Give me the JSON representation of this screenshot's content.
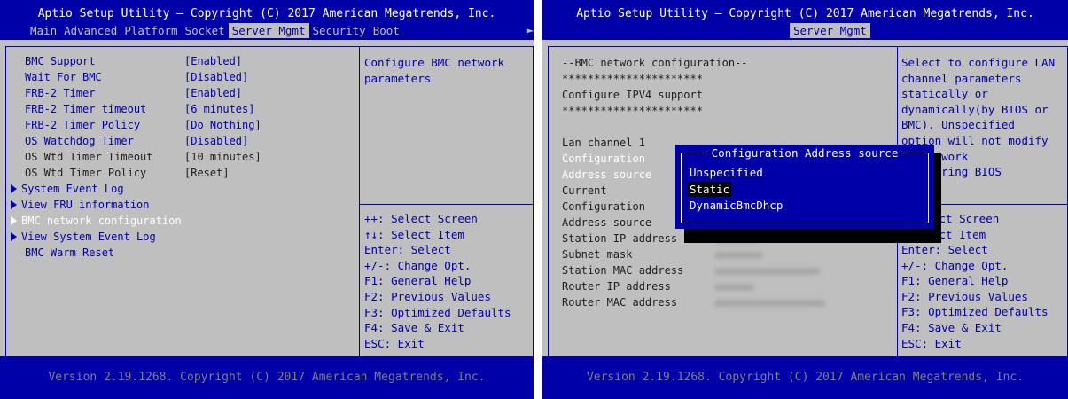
{
  "left": {
    "title": "Aptio Setup Utility – Copyright (C) 2017 American Megatrends, Inc.",
    "tabs": [
      {
        "label": "Main"
      },
      {
        "label": "Advanced"
      },
      {
        "label": "Platform"
      },
      {
        "label": "Socket"
      },
      {
        "label": "Server Mgmt"
      },
      {
        "label": "Security"
      },
      {
        "label": "Boot"
      }
    ],
    "items": [
      {
        "label": "BMC Support",
        "value": "[Enabled]"
      },
      {
        "label": "Wait For BMC",
        "value": "[Disabled]"
      },
      {
        "label": "FRB-2 Timer",
        "value": "[Enabled]"
      },
      {
        "label": "FRB-2 Timer timeout",
        "value": "[6 minutes]"
      },
      {
        "label": "FRB-2 Timer Policy",
        "value": "[Do Nothing]"
      },
      {
        "label": "OS Watchdog Timer",
        "value": "[Disabled]"
      },
      {
        "label": "OS Wtd Timer Timeout",
        "value": "[10 minutes]"
      },
      {
        "label": "OS Wtd Timer Policy",
        "value": "[Reset]"
      },
      {
        "label": "System Event Log",
        "value": ""
      },
      {
        "label": "View FRU information",
        "value": ""
      },
      {
        "label": "BMC network configuration",
        "value": ""
      },
      {
        "label": "View System Event Log",
        "value": ""
      },
      {
        "label": "BMC Warm Reset",
        "value": ""
      }
    ],
    "help": "Configure BMC network\nparameters",
    "keys": [
      "++: Select Screen",
      "↑↓: Select Item",
      "Enter: Select",
      "+/-: Change Opt.",
      "F1: General Help",
      "F2: Previous Values",
      "F3: Optimized Defaults",
      "F4: Save & Exit",
      "ESC: Exit"
    ],
    "footer": "Version 2.19.1268. Copyright (C) 2017 American Megatrends, Inc."
  },
  "right": {
    "title": "Aptio Setup Utility – Copyright (C) 2017 American Megatrends, Inc.",
    "tab": "Server Mgmt",
    "lines": [
      "--BMC network configuration--",
      "**********************",
      "Configure IPV4 support",
      "**********************"
    ],
    "lan_channel": "Lan channel 1",
    "rows": [
      {
        "label": "Configuration"
      },
      {
        "label": "Address source"
      },
      {
        "label": "Current"
      },
      {
        "label": "Configuration"
      },
      {
        "label": "Address source"
      },
      {
        "label": "Station IP address"
      },
      {
        "label": "Subnet mask"
      },
      {
        "label": "Station MAC address"
      },
      {
        "label": "Router IP address"
      },
      {
        "label": "Router MAC address"
      }
    ],
    "help": "Select to configure LAN\nchannel parameters\nstatically or\ndynamically(by BIOS or\nBMC). Unspecified\noption will not modify\nMC network\ners during BIOS",
    "keys": [
      "ect Screen",
      "ect Item",
      "Enter: Select",
      "+/-: Change Opt.",
      "F1: General Help",
      "F2: Previous Values",
      "F3: Optimized Defaults",
      "F4: Save & Exit",
      "ESC: Exit"
    ],
    "popup": {
      "title": "Configuration Address source",
      "options": [
        "Unspecified",
        "Static",
        "DynamicBmcDhcp"
      ],
      "selected": "Static"
    },
    "footer": "Version 2.19.1268. Copyright (C) 2017 American Megatrends, Inc."
  },
  "colors": {
    "bios_blue": "#0000a8",
    "bios_gray": "#bfbfbf",
    "highlight": "#ffffff"
  }
}
